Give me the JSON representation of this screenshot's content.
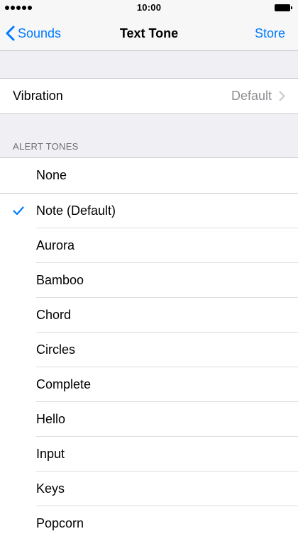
{
  "status_bar": {
    "time": "10:00",
    "signal_dots": 5,
    "battery_level": 1.0
  },
  "nav": {
    "back_label": "Sounds",
    "title": "Text Tone",
    "store_label": "Store"
  },
  "vibration": {
    "label": "Vibration",
    "value": "Default"
  },
  "alert_tones": {
    "header": "ALERT TONES",
    "none_label": "None",
    "selected": "Note (Default)",
    "items": [
      "Note (Default)",
      "Aurora",
      "Bamboo",
      "Chord",
      "Circles",
      "Complete",
      "Hello",
      "Input",
      "Keys",
      "Popcorn"
    ]
  },
  "colors": {
    "accent": "#007aff",
    "background": "#efeff4",
    "secondary_text": "#8e8e93"
  }
}
